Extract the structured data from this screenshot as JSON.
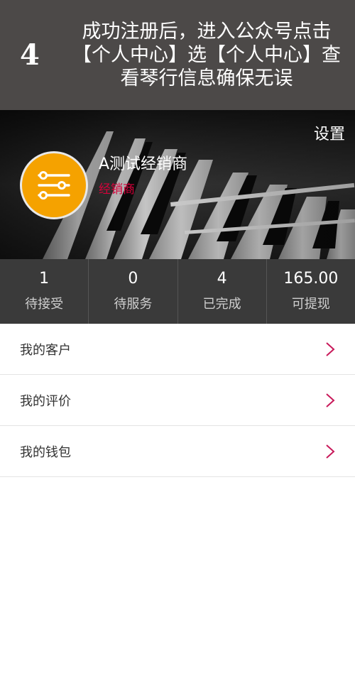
{
  "banner": {
    "step": "4",
    "instruction": "成功注册后，进入公众号点击【个人中心】选【个人中心】查看琴行信息确保无误"
  },
  "profile": {
    "settings_label": "设置",
    "name": "A测试经销商",
    "role": "经销商",
    "avatar_icon": "sliders-icon",
    "avatar_color": "#f5a200",
    "role_color": "#d8003a"
  },
  "stats": [
    {
      "value": "1",
      "label": "待接受"
    },
    {
      "value": "0",
      "label": "待服务"
    },
    {
      "value": "4",
      "label": "已完成"
    },
    {
      "value": "165.00",
      "label": "可提现"
    }
  ],
  "menu": [
    {
      "label": "我的客户"
    },
    {
      "label": "我的评价"
    },
    {
      "label": "我的钱包"
    }
  ],
  "chevron_color": "#c8195a"
}
